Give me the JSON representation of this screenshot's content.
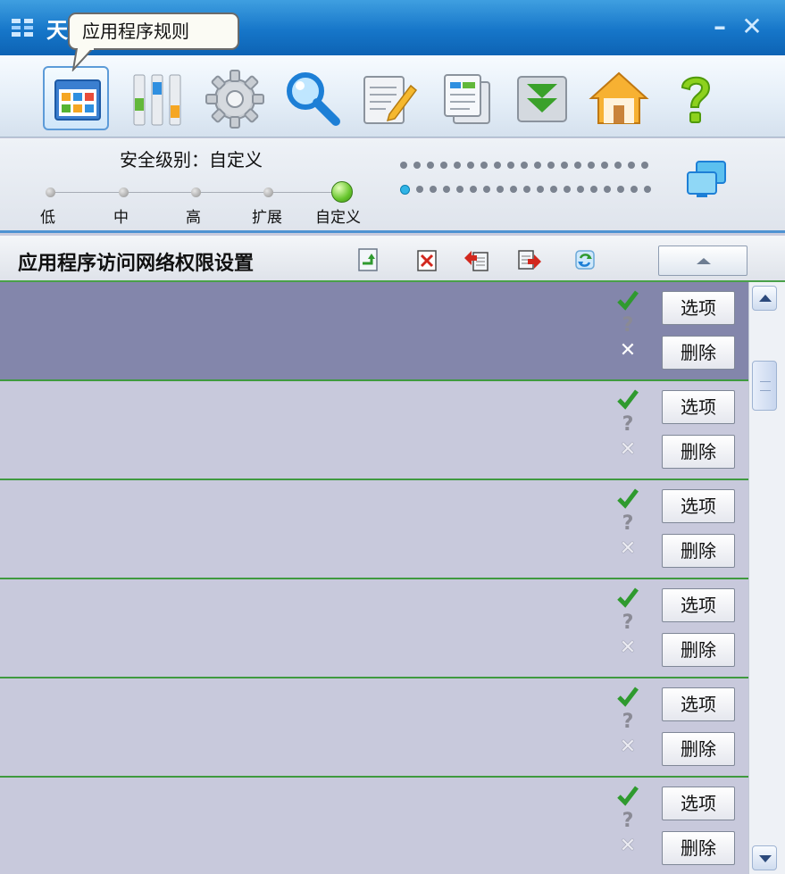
{
  "window": {
    "title": "天",
    "minimize_label": "–",
    "close_label": "✕",
    "tooltip": "应用程序规则"
  },
  "toolbar": {
    "items": [
      {
        "icon": "app-rules-icon",
        "selected": true
      },
      {
        "icon": "network-monitor-icon"
      },
      {
        "icon": "gear-icon"
      },
      {
        "icon": "search-icon"
      },
      {
        "icon": "log-edit-icon"
      },
      {
        "icon": "documents-icon"
      },
      {
        "icon": "download-icon"
      },
      {
        "icon": "home-icon"
      },
      {
        "icon": "help-icon"
      }
    ]
  },
  "security": {
    "level_label": "安全级别：自定义",
    "levels": [
      "低",
      "中",
      "高",
      "扩展",
      "自定义"
    ],
    "active_level": "自定义"
  },
  "section": {
    "title": "应用程序访问网络权限设置",
    "icons": [
      "add-rule-icon",
      "delete-rule-icon",
      "import-icon",
      "export-icon",
      "refresh-icon"
    ]
  },
  "rules": {
    "rows": [
      {
        "selected": true,
        "option_label": "选项",
        "delete_label": "删除",
        "q_glyph": "?",
        "x_glyph": "✕"
      },
      {
        "selected": false,
        "option_label": "选项",
        "delete_label": "删除",
        "q_glyph": "?",
        "x_glyph": "✕"
      },
      {
        "selected": false,
        "option_label": "选项",
        "delete_label": "删除",
        "q_glyph": "?",
        "x_glyph": "✕"
      },
      {
        "selected": false,
        "option_label": "选项",
        "delete_label": "删除",
        "q_glyph": "?",
        "x_glyph": "✕"
      },
      {
        "selected": false,
        "option_label": "选项",
        "delete_label": "删除",
        "q_glyph": "?",
        "x_glyph": "✕"
      },
      {
        "selected": false,
        "option_label": "选项",
        "delete_label": "删除",
        "q_glyph": "?",
        "x_glyph": "✕"
      }
    ]
  },
  "colors": {
    "titlebar": "#1676c9",
    "row_selected": "#8386ab",
    "row": "#c8c9dc",
    "row_border": "#3f9a3f"
  }
}
